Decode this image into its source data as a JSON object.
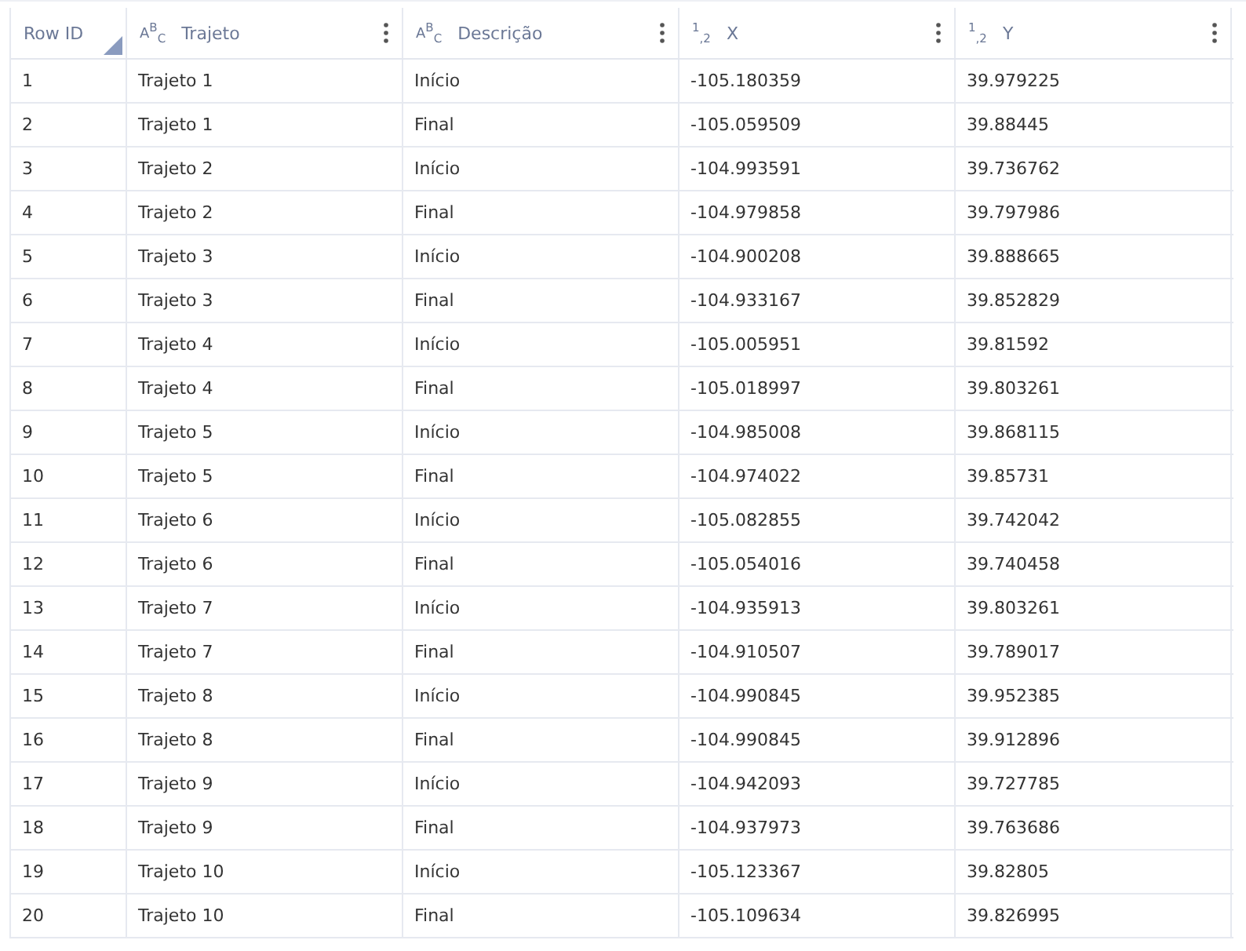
{
  "table": {
    "columns": [
      {
        "label": "Row ID",
        "sorted": true,
        "menu": false
      },
      {
        "label": "Trajeto",
        "type_label": "A$^{B}$$_{C}$",
        "sorted": false,
        "menu": true
      },
      {
        "label": "Descrição",
        "type_label": "A$^{B}$$_{C}$",
        "sorted": false,
        "menu": true
      },
      {
        "label": "X",
        "type_label": "$^{1}$$_{,2}$",
        "sorted": false,
        "menu": true
      },
      {
        "label": "Y",
        "type_label": "$^{1}$$_{,2}$",
        "sorted": false,
        "menu": true
      }
    ],
    "rows": [
      [
        "1",
        "Trajeto 1",
        "Início",
        "-105.180359",
        "39.979225"
      ],
      [
        "2",
        "Trajeto 1",
        "Final",
        "-105.059509",
        "39.88445"
      ],
      [
        "3",
        "Trajeto 2",
        "Início",
        "-104.993591",
        "39.736762"
      ],
      [
        "4",
        "Trajeto 2",
        "Final",
        "-104.979858",
        "39.797986"
      ],
      [
        "5",
        "Trajeto 3",
        "Início",
        "-104.900208",
        "39.888665"
      ],
      [
        "6",
        "Trajeto 3",
        "Final",
        "-104.933167",
        "39.852829"
      ],
      [
        "7",
        "Trajeto 4",
        "Início",
        "-105.005951",
        "39.81592"
      ],
      [
        "8",
        "Trajeto 4",
        "Final",
        "-105.018997",
        "39.803261"
      ],
      [
        "9",
        "Trajeto 5",
        "Início",
        "-104.985008",
        "39.868115"
      ],
      [
        "10",
        "Trajeto 5",
        "Final",
        "-104.974022",
        "39.85731"
      ],
      [
        "11",
        "Trajeto 6",
        "Início",
        "-105.082855",
        "39.742042"
      ],
      [
        "12",
        "Trajeto 6",
        "Final",
        "-105.054016",
        "39.740458"
      ],
      [
        "13",
        "Trajeto 7",
        "Início",
        "-104.935913",
        "39.803261"
      ],
      [
        "14",
        "Trajeto 7",
        "Final",
        "-104.910507",
        "39.789017"
      ],
      [
        "15",
        "Trajeto 8",
        "Início",
        "-104.990845",
        "39.952385"
      ],
      [
        "16",
        "Trajeto 8",
        "Final",
        "-104.990845",
        "39.912896"
      ],
      [
        "17",
        "Trajeto 9",
        "Início",
        "-104.942093",
        "39.727785"
      ],
      [
        "18",
        "Trajeto 9",
        "Final",
        "-104.937973",
        "39.763686"
      ],
      [
        "19",
        "Trajeto 10",
        "Início",
        "-105.123367",
        "39.82805"
      ],
      [
        "20",
        "Trajeto 10",
        "Final",
        "-105.109634",
        "39.826995"
      ]
    ]
  }
}
